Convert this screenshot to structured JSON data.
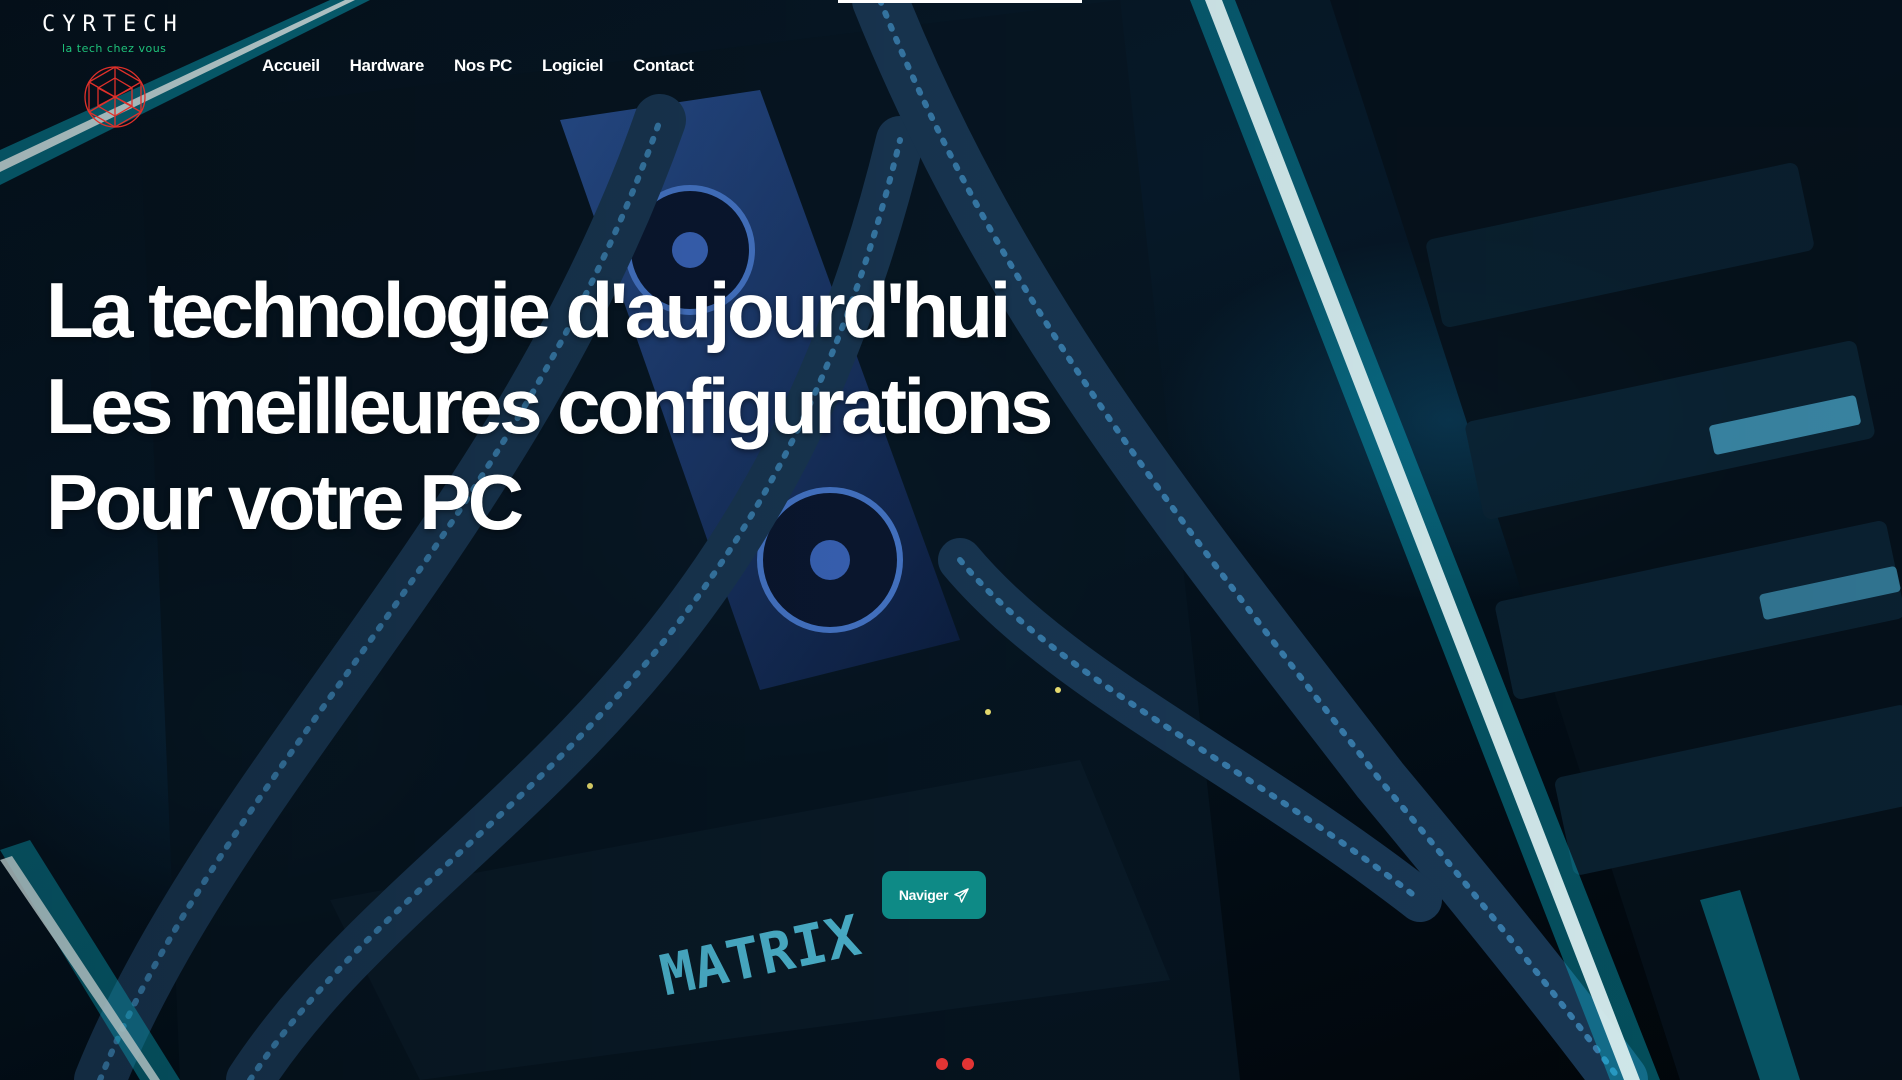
{
  "brand": {
    "name": "CYRTECH",
    "tagline": "la tech chez vous",
    "logo_icon": "red-geodesic-sphere-icon",
    "accent_color": "#1fc27a",
    "logo_color": "#e0302a"
  },
  "nav": {
    "items": [
      {
        "label": "Accueil"
      },
      {
        "label": "Hardware"
      },
      {
        "label": "Nos PC"
      },
      {
        "label": "Logiciel"
      },
      {
        "label": "Contact"
      }
    ]
  },
  "hero": {
    "lines": [
      "La technologie d'aujourd'hui",
      "Les meilleures configurations",
      "Pour votre PC"
    ],
    "background_icon": "pc-internals-neon-photo",
    "cta": {
      "label": "Naviger",
      "icon": "paper-plane-icon",
      "color": "#0e8a86"
    }
  }
}
